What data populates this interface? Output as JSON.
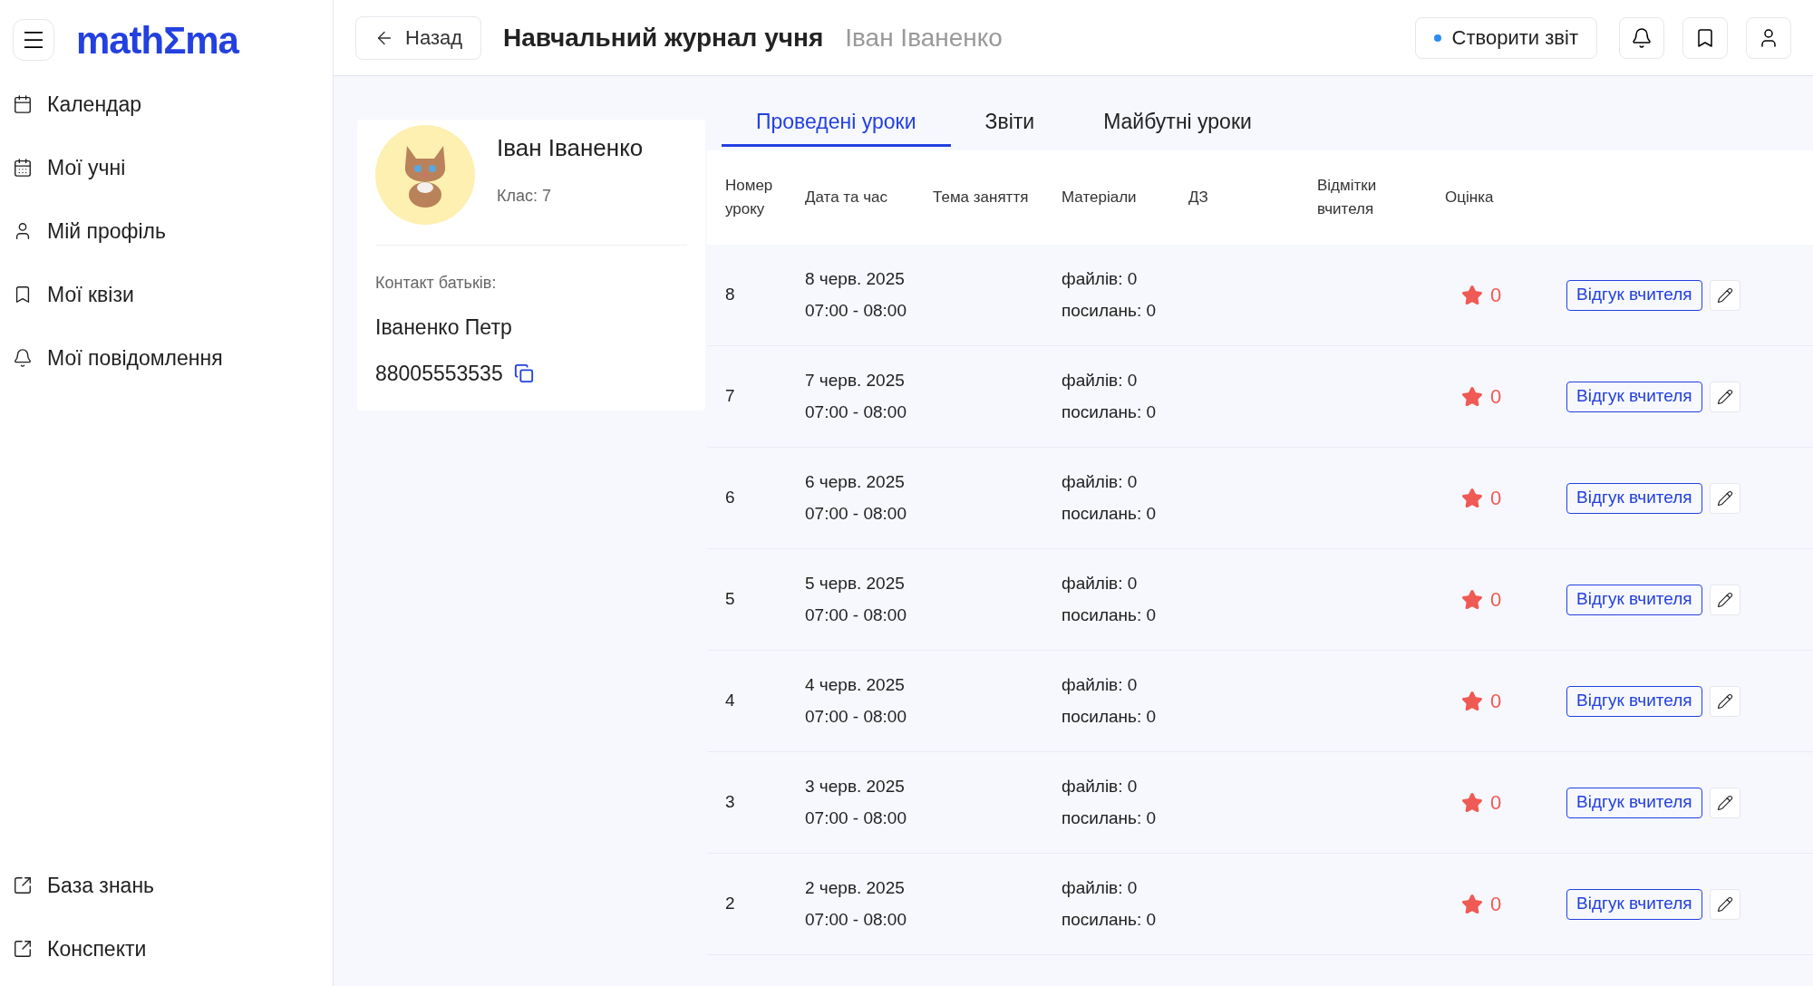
{
  "sidebar": {
    "logo": "mathΣma",
    "items": [
      {
        "label": "Календар",
        "kind": "calendar"
      },
      {
        "label": "Мої учні",
        "kind": "students"
      },
      {
        "label": "Мій профіль",
        "kind": "profile"
      },
      {
        "label": "Мої квізи",
        "kind": "quizzes"
      },
      {
        "label": "Мої повідомлення",
        "kind": "messages"
      }
    ],
    "bottom_items": [
      {
        "label": "База знань",
        "kind": "external"
      },
      {
        "label": "Конспекти",
        "kind": "external"
      }
    ]
  },
  "header": {
    "back": "Назад",
    "title": "Навчальний журнал учня",
    "subtitle": "Іван Іваненко",
    "report_button": "Створити звіт"
  },
  "profile": {
    "name": "Іван Іваненко",
    "class": "Клас: 7",
    "contact_label": "Контакт батьків:",
    "parent": "Іваненко Петр",
    "phone": "88005553535"
  },
  "tabs": [
    {
      "label": "Проведені уроки",
      "selected": true
    },
    {
      "label": "Звіти",
      "selected": false
    },
    {
      "label": "Майбутні уроки",
      "selected": false
    }
  ],
  "table": {
    "columns": [
      "Номер уроку",
      "Дата та час",
      "Тема заняття",
      "Матеріали",
      "ДЗ",
      "Відмітки вчителя",
      "Оцінка"
    ],
    "rows": [
      {
        "number": "8",
        "date": "8 черв. 2025",
        "time": "07:00 - 08:00",
        "files": "файлів: 0",
        "links": "посилань: 0",
        "rating": "0",
        "feedback": "Відгук вчителя"
      },
      {
        "number": "7",
        "date": "7 черв. 2025",
        "time": "07:00 - 08:00",
        "files": "файлів: 0",
        "links": "посилань: 0",
        "rating": "0",
        "feedback": "Відгук вчителя"
      },
      {
        "number": "6",
        "date": "6 черв. 2025",
        "time": "07:00 - 08:00",
        "files": "файлів: 0",
        "links": "посилань: 0",
        "rating": "0",
        "feedback": "Відгук вчителя"
      },
      {
        "number": "5",
        "date": "5 черв. 2025",
        "time": "07:00 - 08:00",
        "files": "файлів: 0",
        "links": "посилань: 0",
        "rating": "0",
        "feedback": "Відгук вчителя"
      },
      {
        "number": "4",
        "date": "4 черв. 2025",
        "time": "07:00 - 08:00",
        "files": "файлів: 0",
        "links": "посилань: 0",
        "rating": "0",
        "feedback": "Відгук вчителя"
      },
      {
        "number": "3",
        "date": "3 черв. 2025",
        "time": "07:00 - 08:00",
        "files": "файлів: 0",
        "links": "посилань: 0",
        "rating": "0",
        "feedback": "Відгук вчителя"
      },
      {
        "number": "2",
        "date": "2 черв. 2025",
        "time": "07:00 - 08:00",
        "files": "файлів: 0",
        "links": "посилань: 0",
        "rating": "0",
        "feedback": "Відгук вчителя"
      }
    ]
  }
}
